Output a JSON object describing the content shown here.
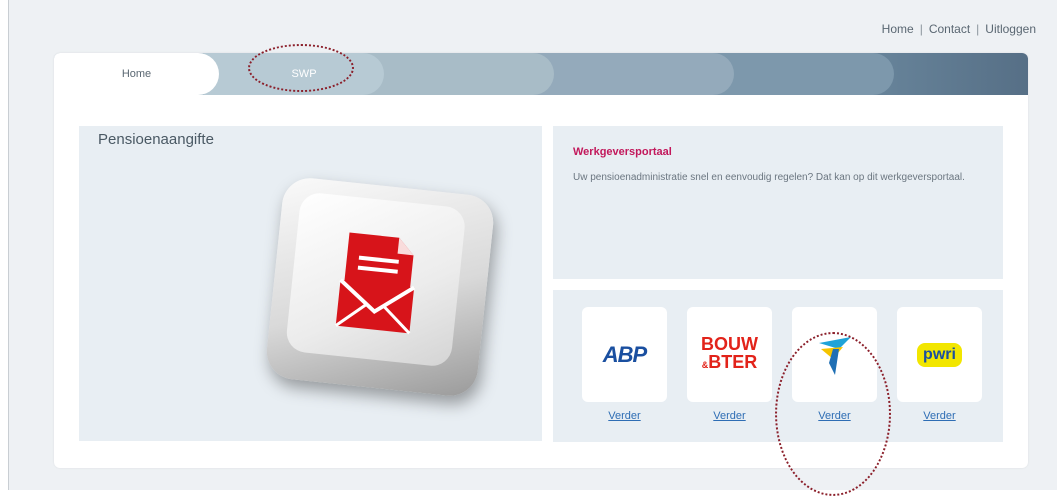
{
  "top_nav": {
    "home": "Home",
    "separator": "|",
    "contact": "Contact",
    "logout": "Uitloggen"
  },
  "tabs": [
    {
      "label": "Home"
    },
    {
      "label": "SWP"
    },
    {
      "label": ""
    },
    {
      "label": ""
    },
    {
      "label": ""
    }
  ],
  "left_panel": {
    "title": "Pensioenaangifte",
    "icon": "envelope-document-icon"
  },
  "right_panel": {
    "title": "Werkgeversportaal",
    "description": "Uw pensioenadministratie snel en eenvoudig regelen? Dat kan op dit werkgeversportaal."
  },
  "providers": [
    {
      "logo": "ABP",
      "link_label": "Verder"
    },
    {
      "logo_line1": "BOUW",
      "logo_amp": "&",
      "logo_line2": "BTER",
      "link_label": "Verder"
    },
    {
      "logo": "stpe-bird-icon",
      "link_label": "Verder"
    },
    {
      "logo": "pwri",
      "link_label": "Verder"
    }
  ],
  "colors": {
    "accent_title": "#c2185b",
    "link": "#2e6db4",
    "annotation": "#8b1f2a",
    "mail_red": "#d7141a"
  }
}
